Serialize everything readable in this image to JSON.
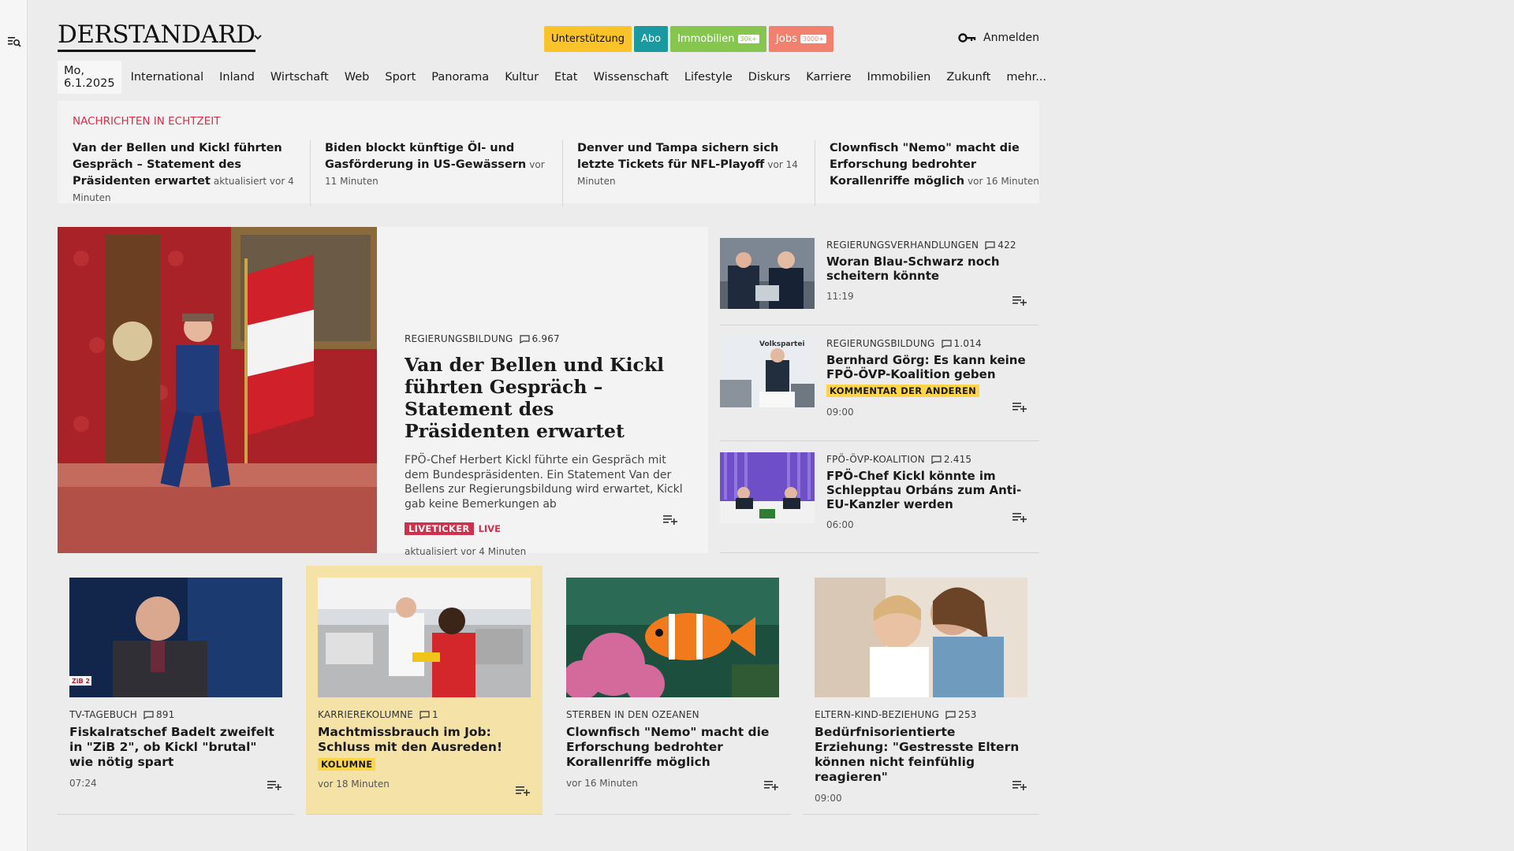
{
  "brand": {
    "logo_text": "DERSTANDARD"
  },
  "header": {
    "pills": [
      {
        "label": "Unterstützung",
        "color": "#fbc32a"
      },
      {
        "label": "Abo",
        "color": "#1a9aa0"
      },
      {
        "label": "Immobilien",
        "badge": "30k+",
        "color": "#86c54e"
      },
      {
        "label": "Jobs",
        "badge": "3000+",
        "color": "#f2806e"
      }
    ],
    "login_label": "Anmelden"
  },
  "nav": {
    "date": "Mo, 6.1.2025",
    "items": [
      "International",
      "Inland",
      "Wirtschaft",
      "Web",
      "Sport",
      "Panorama",
      "Kultur",
      "Etat",
      "Wissenschaft",
      "Lifestyle",
      "Diskurs",
      "Karriere",
      "Immobilien",
      "Zukunft",
      "mehr..."
    ]
  },
  "ticker": {
    "title": "NACHRICHTEN IN ECHTZEIT",
    "items": [
      {
        "headline": "Van der Bellen und Kickl führten Ge­spräch – Statement des Präsidenten erwartet",
        "time": "aktualisiert vor 4 Minuten"
      },
      {
        "headline": "Biden blockt künftige Öl- und Gasför­derung in US-Gewässern",
        "time": "vor 11 Minuten"
      },
      {
        "headline": "Denver und Tampa sichern sich letzte Tickets für NFL-Playoff",
        "time": "vor 14 Minuten"
      },
      {
        "headline": "Clownfisch \"Nemo\" macht die Erfor­schung bedrohter Korallenriffe mög­lich",
        "time": "vor 16 Minuten"
      }
    ]
  },
  "lead": {
    "kicker": "REGIERUNGSBILDUNG",
    "comments": "6.967",
    "title": "Van der Bellen und Kickl führten Gespräch – Statement des Präsidenten erwartet",
    "teaser": "FPÖ-Chef Herbert Kickl führte ein Gespräch mit dem Bundespräsidenten. Ein Statement Van der Bellens zur Regierungsbildung wird erwartet, Kickl gab keine Bemerkungen ab",
    "tag": "LIVETICKER",
    "live": "LIVE",
    "time": "aktualisiert vor 4 Minuten"
  },
  "side": [
    {
      "kicker": "REGIERUNGSVERHANDLUNGEN",
      "comments": "422",
      "title": "Woran Blau-Schwarz noch scheitern könnte",
      "time": "11:19"
    },
    {
      "kicker": "REGIERUNGSBILDUNG",
      "comments": "1.014",
      "title": "Bernhard Görg: Es kann keine FPÖ-ÖVP-Koalition geben",
      "label": "KOMMENTAR DER ANDEREN",
      "time": "09:00"
    },
    {
      "kicker": "FPÖ-ÖVP-KOALITION",
      "comments": "2.415",
      "title": "FPÖ-Chef Kickl könnte im Schlepptau Orbáns zum Anti-EU-Kanzler werden",
      "time": "06:00"
    }
  ],
  "cards": [
    {
      "kicker": "TV-TAGEBUCH",
      "comments": "891",
      "title": "Fiskalratschef Badelt zweifelt in \"ZiB 2\", ob Kickl \"brutal\" wie nötig spart",
      "time": "07:24"
    },
    {
      "kicker": "KARRIEREKOLUMNE",
      "comments": "1",
      "title": "Machtmissbrauch im Job: Schluss mit den Ausreden!",
      "label": "KOLUMNE",
      "time": "vor 18 Minuten"
    },
    {
      "kicker": "STERBEN IN DEN OZEANEN",
      "title": "Clownfisch \"Nemo\" macht die Erforschung bedrohter Korallenriffe möglich",
      "time": "vor 16 Minuten"
    },
    {
      "kicker": "ELTERN-KIND-BEZIEHUNG",
      "comments": "253",
      "title": "Bedürfnisorientierte Erziehung: \"Gestresste Eltern können nicht feinfühlig reagieren\"",
      "time": "09:00"
    }
  ],
  "image_overlay": {
    "zib_badge": "ZiB 2",
    "podium_text": "Volkspartei"
  },
  "colors": {
    "accent_red": "#d0304a",
    "highlight_yellow": "#fdd54a",
    "card_yellow": "#f5e2a7"
  }
}
